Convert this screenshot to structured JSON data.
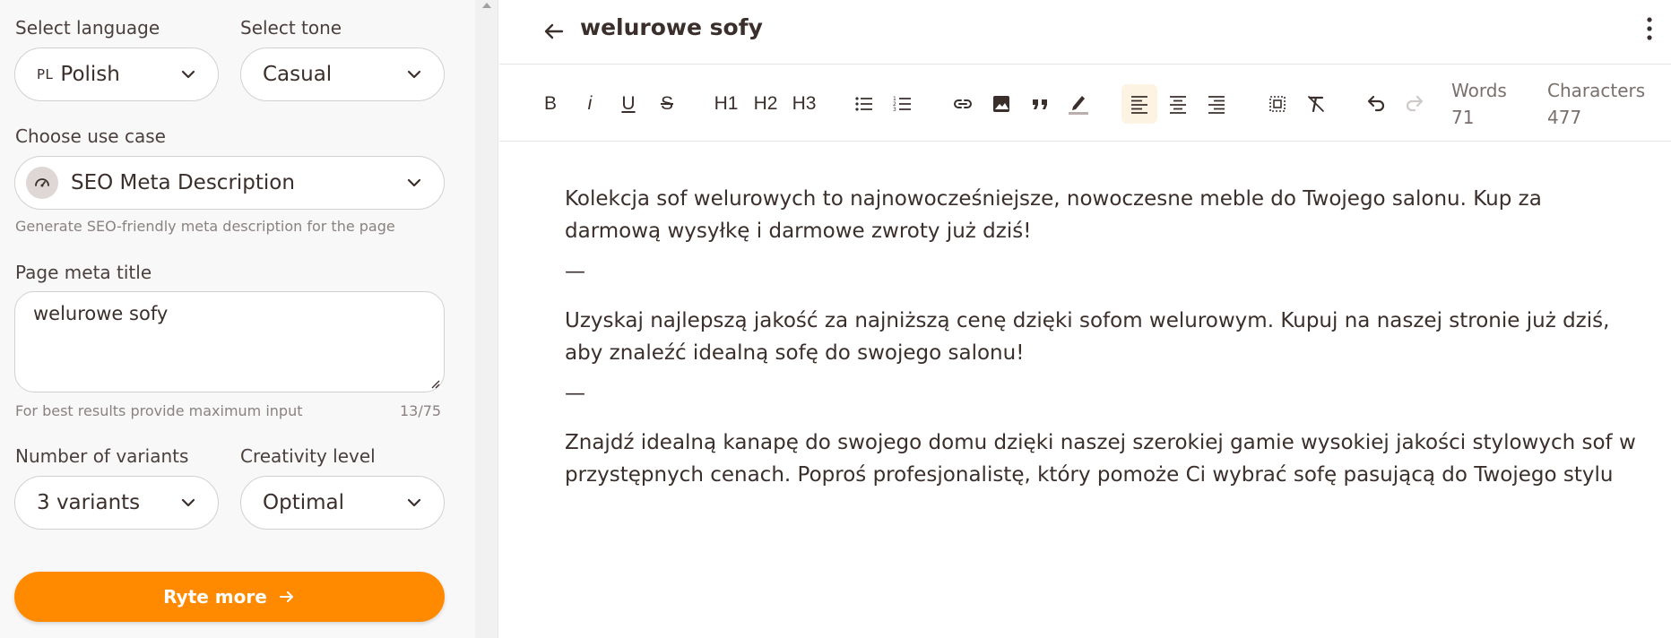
{
  "sidebar": {
    "language": {
      "label": "Select language",
      "code": "PL",
      "value": "Polish"
    },
    "tone": {
      "label": "Select tone",
      "value": "Casual"
    },
    "use_case": {
      "label": "Choose use case",
      "value": "SEO Meta Description",
      "icon": "gauge-icon",
      "hint": "Generate SEO-friendly meta description for the page"
    },
    "meta_title": {
      "label": "Page meta title",
      "value": "welurowe sofy",
      "hint": "For best results provide maximum input",
      "counter": "13/75"
    },
    "variants": {
      "label": "Number of variants",
      "value": "3 variants"
    },
    "creativity": {
      "label": "Creativity level",
      "value": "Optimal"
    },
    "ryte_button": {
      "label": "Ryte more"
    }
  },
  "header": {
    "title": "welurowe sofy"
  },
  "toolbar": {
    "bold": "B",
    "italic": "i",
    "underline": "U",
    "strike": "S",
    "h1": "H1",
    "h2": "H2",
    "h3": "H3",
    "stats": {
      "words_label": "Words",
      "words_value": "71",
      "chars_label": "Characters",
      "chars_value": "477"
    }
  },
  "editor": {
    "paragraphs": [
      "Kolekcja sof welurowych to najnowocześniejsze, nowoczesne meble do Twojego salonu. Kup za darmową wysyłkę i darmowe zwroty już dziś!",
      "Uzyskaj najlepszą jakość za najniższą cenę dzięki sofom welurowym. Kupuj na naszej stronie już dziś, aby znaleźć idealną sofę do swojego salonu!",
      "Znajdź idealną kanapę do swojego domu dzięki naszej szerokiej gamie wysokiej jakości stylowych sof w przystępnych cenach. Poproś profesjonalistę, który pomoże Ci wybrać sofę pasującą do Twojego stylu"
    ],
    "separator": "—"
  },
  "colors": {
    "accent": "#ff8a00",
    "text": "#3b2f2c",
    "sidebar_bg": "#f8f8f8",
    "active_tool_bg": "#fdf3e2"
  }
}
